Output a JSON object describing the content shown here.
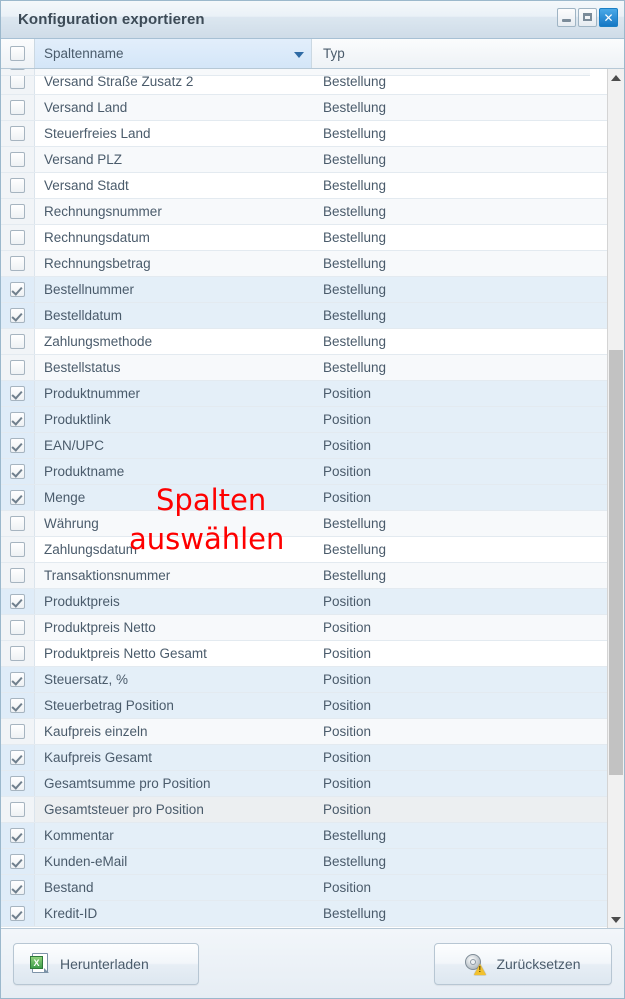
{
  "window": {
    "title": "Konfiguration exportieren",
    "buttons": {
      "minimize": "minimize-button",
      "maximize": "maximize-button",
      "close": "✕"
    }
  },
  "grid": {
    "headers": {
      "select_all": "",
      "name": "Spaltenname",
      "type": "Typ"
    },
    "partial_row": {
      "name": "",
      "type": "",
      "checked": false
    },
    "rows": [
      {
        "name": "Versand Straße Zusatz 2",
        "type": "Bestellung",
        "checked": false
      },
      {
        "name": "Versand Land",
        "type": "Bestellung",
        "checked": false
      },
      {
        "name": "Steuerfreies Land",
        "type": "Bestellung",
        "checked": false
      },
      {
        "name": "Versand PLZ",
        "type": "Bestellung",
        "checked": false
      },
      {
        "name": "Versand Stadt",
        "type": "Bestellung",
        "checked": false
      },
      {
        "name": "Rechnungsnummer",
        "type": "Bestellung",
        "checked": false
      },
      {
        "name": "Rechnungsdatum",
        "type": "Bestellung",
        "checked": false
      },
      {
        "name": "Rechnungsbetrag",
        "type": "Bestellung",
        "checked": false
      },
      {
        "name": "Bestellnummer",
        "type": "Bestellung",
        "checked": true
      },
      {
        "name": "Bestelldatum",
        "type": "Bestellung",
        "checked": true
      },
      {
        "name": "Zahlungsmethode",
        "type": "Bestellung",
        "checked": false
      },
      {
        "name": "Bestellstatus",
        "type": "Bestellung",
        "checked": false
      },
      {
        "name": "Produktnummer",
        "type": "Position",
        "checked": true
      },
      {
        "name": "Produktlink",
        "type": "Position",
        "checked": true
      },
      {
        "name": "EAN/UPC",
        "type": "Position",
        "checked": true
      },
      {
        "name": "Produktname",
        "type": "Position",
        "checked": true
      },
      {
        "name": "Menge",
        "type": "Position",
        "checked": true
      },
      {
        "name": "Währung",
        "type": "Bestellung",
        "checked": false
      },
      {
        "name": "Zahlungsdatum",
        "type": "Bestellung",
        "checked": false
      },
      {
        "name": "Transaktionsnummer",
        "type": "Bestellung",
        "checked": false
      },
      {
        "name": "Produktpreis",
        "type": "Position",
        "checked": true
      },
      {
        "name": "Produktpreis Netto",
        "type": "Position",
        "checked": false
      },
      {
        "name": "Produktpreis Netto Gesamt",
        "type": "Position",
        "checked": false
      },
      {
        "name": "Steuersatz, %",
        "type": "Position",
        "checked": true
      },
      {
        "name": "Steuerbetrag Position",
        "type": "Position",
        "checked": true
      },
      {
        "name": "Kaufpreis einzeln",
        "type": "Position",
        "checked": false
      },
      {
        "name": "Kaufpreis Gesamt",
        "type": "Position",
        "checked": true
      },
      {
        "name": "Gesamtsumme pro Position",
        "type": "Position",
        "checked": true
      },
      {
        "name": "Gesamtsteuer pro Position",
        "type": "Position",
        "checked": false,
        "hover": true
      },
      {
        "name": "Kommentar",
        "type": "Bestellung",
        "checked": true
      },
      {
        "name": "Kunden-eMail",
        "type": "Bestellung",
        "checked": true
      },
      {
        "name": "Bestand",
        "type": "Position",
        "checked": true
      },
      {
        "name": "Kredit-ID",
        "type": "Bestellung",
        "checked": true
      }
    ]
  },
  "scrollbar": {
    "up_arrow": "scroll-up-arrow",
    "down_arrow": "scroll-down-arrow"
  },
  "footer": {
    "download_label": "Herunterladen",
    "reset_label": "Zurücksetzen"
  },
  "annotation": {
    "line1": "Spalten",
    "line2": "auswählen",
    "color": "#fe0000"
  }
}
